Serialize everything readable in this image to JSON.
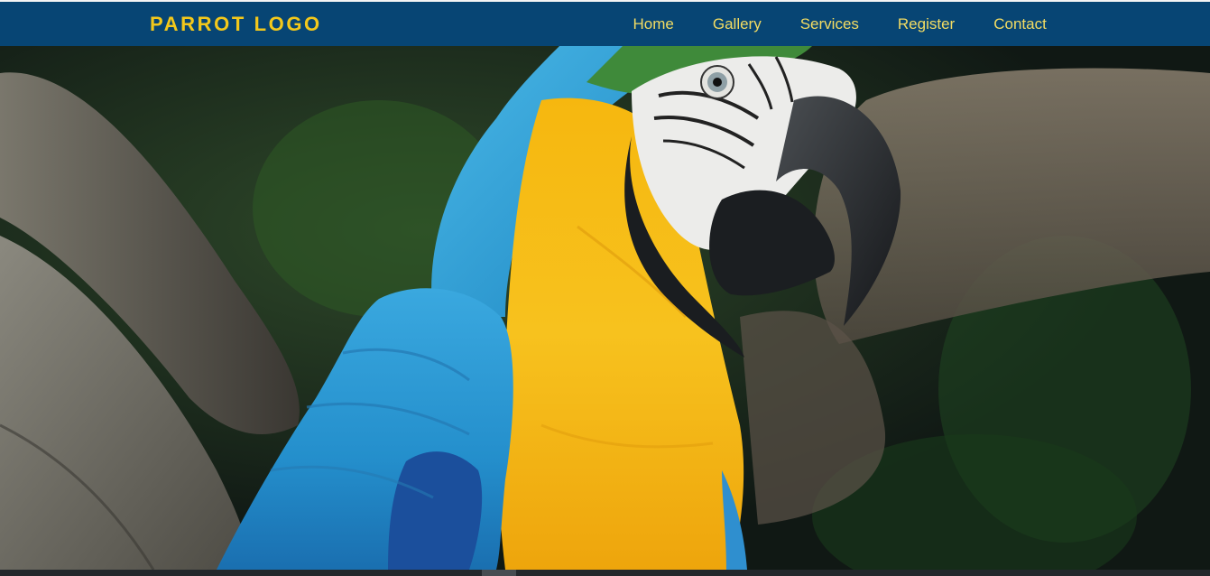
{
  "header": {
    "logo_text": "PARROT LOGO",
    "nav": [
      {
        "label": "Home"
      },
      {
        "label": "Gallery"
      },
      {
        "label": "Services"
      },
      {
        "label": "Register"
      },
      {
        "label": "Contact"
      }
    ]
  },
  "hero": {
    "image_subject": "blue-and-yellow macaw perched on a branch"
  },
  "colors": {
    "navbar_bg": "#074574",
    "logo": "#f3c81b",
    "nav_link": "#f3dc63"
  }
}
